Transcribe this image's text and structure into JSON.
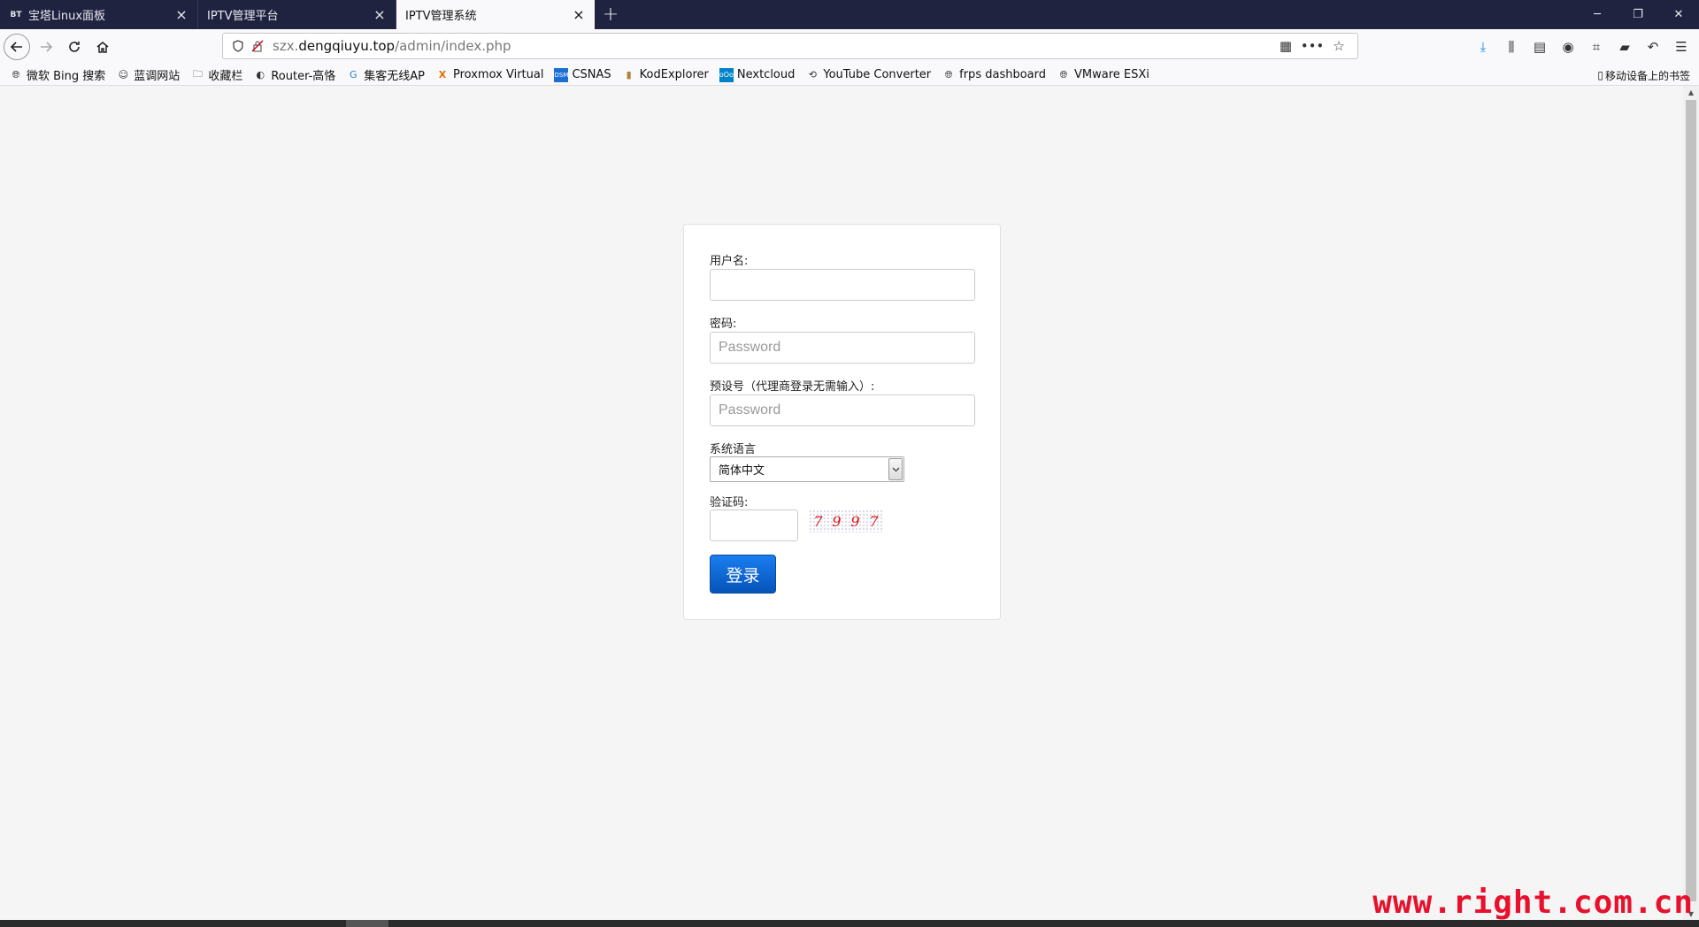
{
  "browser": {
    "tabs": [
      {
        "favicon": "BT",
        "label": "宝塔Linux面板",
        "active": false
      },
      {
        "favicon": "",
        "label": "IPTV管理平台",
        "active": false
      },
      {
        "favicon": "",
        "label": "IPTV管理系统",
        "active": true
      }
    ],
    "new_tab_icon": "plus-icon",
    "window_controls": {
      "minimize": "─",
      "restore": "❐",
      "close": "✕"
    },
    "nav": {
      "back": "back-arrow-icon",
      "forward": "forward-arrow-icon",
      "reload": "reload-icon",
      "home": "home-icon"
    },
    "url": {
      "prefix": "szx.",
      "domain": "dengqiuyu.top",
      "path": "/admin/index.php"
    },
    "bookmarks": [
      {
        "label": "微软 Bing 搜索",
        "icon": "globe-icon"
      },
      {
        "label": "蓝调网站",
        "icon": "site-icon"
      },
      {
        "label": "收藏栏",
        "icon": "folder-icon"
      },
      {
        "label": "Router-高恪",
        "icon": "router-icon"
      },
      {
        "label": "集客无线AP",
        "icon": "wifi-ap-icon"
      },
      {
        "label": "Proxmox Virtual",
        "icon": "proxmox-icon"
      },
      {
        "label": "CSNAS",
        "icon": "dsm-icon"
      },
      {
        "label": "KodExplorer",
        "icon": "kod-icon"
      },
      {
        "label": "Nextcloud",
        "icon": "nextcloud-icon"
      },
      {
        "label": "YouTube Converter",
        "icon": "converter-icon"
      },
      {
        "label": "frps dashboard",
        "icon": "globe-icon"
      },
      {
        "label": "VMware ESXi",
        "icon": "globe-icon"
      }
    ],
    "mobile_bookmarks": "移动设备上的书签"
  },
  "login_form": {
    "username_label": "用户名:",
    "username_value": "",
    "password_label": "密码:",
    "password_placeholder": "Password",
    "preset_label": "预设号（代理商登录无需输入）:",
    "preset_placeholder": "Password",
    "language_label": "系统语言",
    "language_selected": "简体中文",
    "captcha_label": "验证码:",
    "captcha_chars": [
      "7",
      "9",
      "9",
      "7"
    ],
    "login_button": "登录"
  },
  "watermark": "www.right.com.cn",
  "colors": {
    "tabstrip": "#202340",
    "login_button": "#0a66d6",
    "captcha_text": "#d11111",
    "watermark": "#e8112d"
  }
}
